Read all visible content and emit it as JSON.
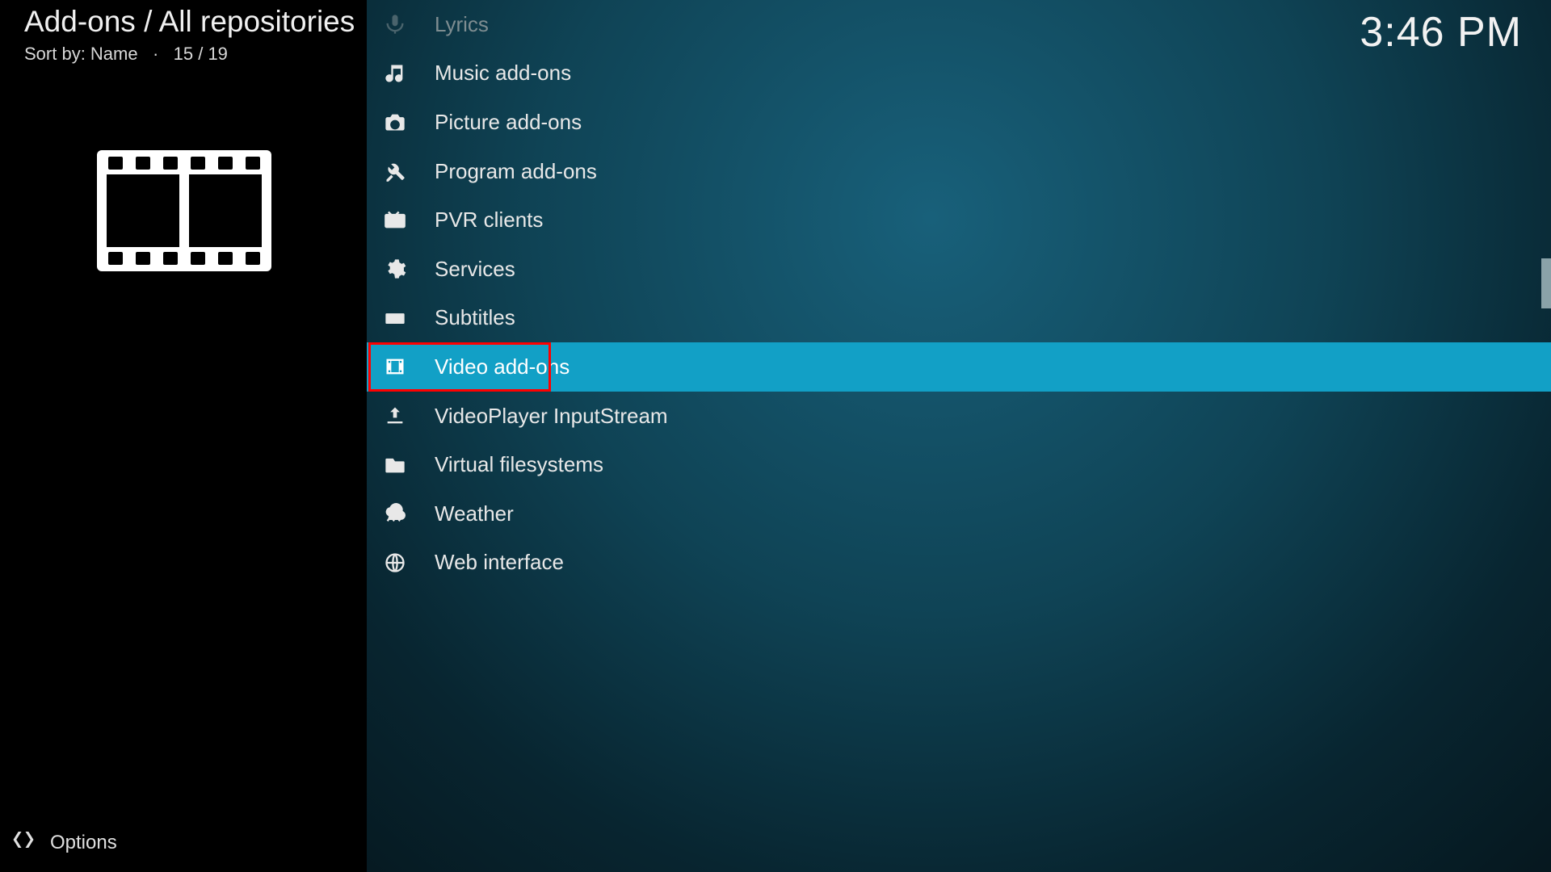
{
  "header": {
    "breadcrumb": "Add-ons / All repositories",
    "sort_label": "Sort by: Name",
    "position": "15 / 19"
  },
  "clock": "3:46 PM",
  "options_label": "Options",
  "list": {
    "items": [
      {
        "icon": "microphone-icon",
        "label": "Lyrics",
        "dim": true
      },
      {
        "icon": "music-icon",
        "label": "Music add-ons"
      },
      {
        "icon": "camera-icon",
        "label": "Picture add-ons"
      },
      {
        "icon": "tools-icon",
        "label": "Program add-ons"
      },
      {
        "icon": "tv-icon",
        "label": "PVR clients"
      },
      {
        "icon": "gear-icon",
        "label": "Services"
      },
      {
        "icon": "keyboard-icon",
        "label": "Subtitles"
      },
      {
        "icon": "film-icon",
        "label": "Video add-ons",
        "selected": true,
        "boxed": true
      },
      {
        "icon": "upload-icon",
        "label": "VideoPlayer InputStream"
      },
      {
        "icon": "folder-icon",
        "label": "Virtual filesystems"
      },
      {
        "icon": "weather-icon",
        "label": "Weather"
      },
      {
        "icon": "globe-icon",
        "label": "Web interface"
      }
    ]
  }
}
